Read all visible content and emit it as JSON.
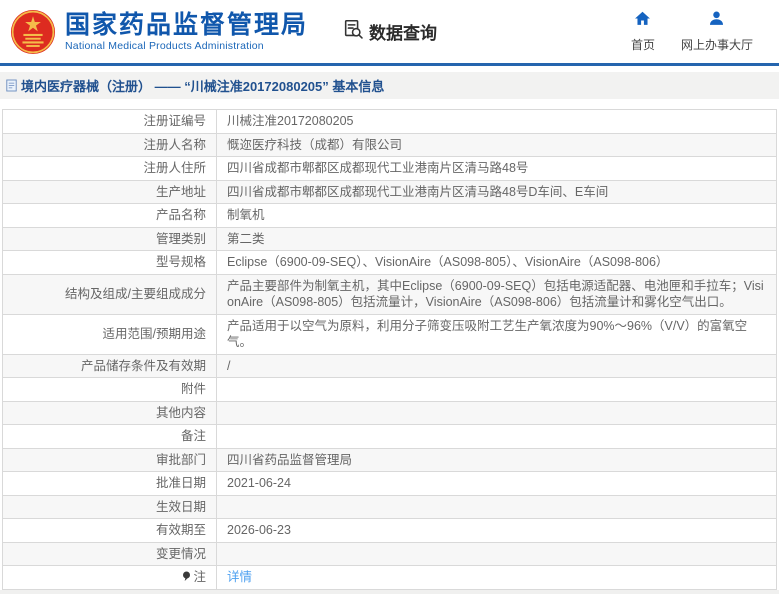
{
  "header": {
    "org_title": "国家药品监督管理局",
    "org_subtitle": "National Medical Products Administration",
    "data_query_label": "数据查询",
    "nav": [
      {
        "label": "首页",
        "icon": "home-icon"
      },
      {
        "label": "网上办事大厅",
        "icon": "person-icon"
      }
    ]
  },
  "page_title": {
    "text": "境内医疗器械（注册） —— “川械注准20172080205” 基本信息"
  },
  "table": {
    "rows": [
      {
        "label": "注册证编号",
        "value": "川械注准20172080205"
      },
      {
        "label": "注册人名称",
        "value": "慨迩医疗科技（成都）有限公司"
      },
      {
        "label": "注册人住所",
        "value": "四川省成都市郫都区成都现代工业港南片区清马路48号"
      },
      {
        "label": "生产地址",
        "value": "四川省成都市郫都区成都现代工业港南片区清马路48号D车间、E车间"
      },
      {
        "label": "产品名称",
        "value": "制氧机"
      },
      {
        "label": "管理类别",
        "value": "第二类"
      },
      {
        "label": "型号规格",
        "value": "Eclipse（6900-09-SEQ）、VisionAire（AS098-805）、VisionAire（AS098-806）"
      },
      {
        "label": "结构及组成/主要组成成分",
        "value": "产品主要部件为制氧主机，其中Eclipse（6900-09-SEQ）包括电源适配器、电池匣和手拉车；VisionAire（AS098-805）包括流量计，VisionAire（AS098-806）包括流量计和雾化空气出口。"
      },
      {
        "label": "适用范围/预期用途",
        "value": "产品适用于以空气为原料，利用分子筛变压吸附工艺生产氧浓度为90%～96%（V/V）的富氧空气。"
      },
      {
        "label": "产品储存条件及有效期",
        "value": "/"
      },
      {
        "label": "附件",
        "value": ""
      },
      {
        "label": "其他内容",
        "value": ""
      },
      {
        "label": "备注",
        "value": ""
      },
      {
        "label": "审批部门",
        "value": "四川省药品监督管理局"
      },
      {
        "label": "批准日期",
        "value": "2021-06-24"
      },
      {
        "label": "生效日期",
        "value": ""
      },
      {
        "label": "有效期至",
        "value": "2026-06-23"
      },
      {
        "label": "变更情况",
        "value": ""
      },
      {
        "label": "注",
        "value": "详情",
        "link": true,
        "icon": "note-icon"
      }
    ]
  },
  "colors": {
    "brand_blue": "#1057ac",
    "icon_blue": "#1563c0",
    "title_blue": "#21518f",
    "link_blue": "#4da0f0",
    "emblem_red": "#dd2b20",
    "emblem_gold": "#f5bc4a"
  }
}
